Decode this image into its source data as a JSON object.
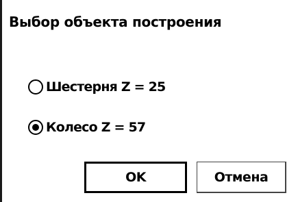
{
  "dialog": {
    "title": "Выбор объекта построения",
    "options": [
      {
        "label": "Шестерня Z = 25",
        "selected": false
      },
      {
        "label": "Колесо Z = 57",
        "selected": true
      }
    ],
    "buttons": {
      "ok_label": "OK",
      "cancel_label": "Отмена"
    }
  },
  "colors": {
    "background": "#ffffff",
    "text": "#000000",
    "border": "#000000"
  }
}
